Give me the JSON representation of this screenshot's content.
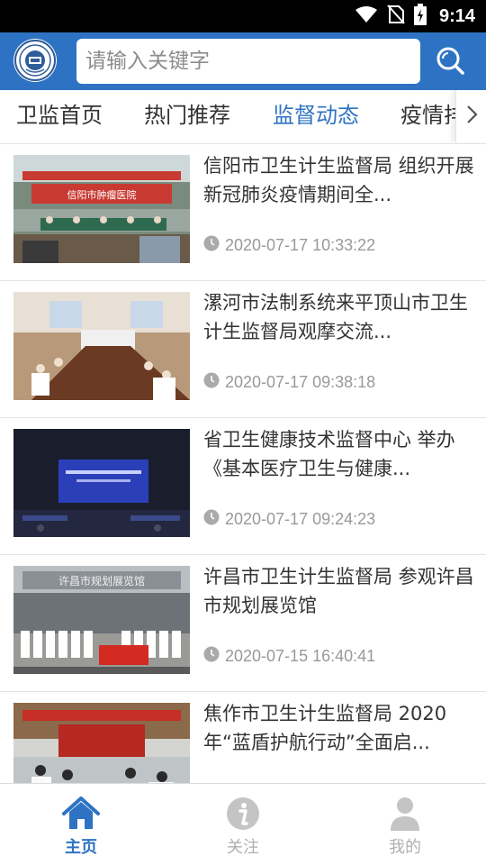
{
  "status_bar": {
    "time": "9:14",
    "icons": [
      "wifi-icon",
      "no-sim-icon",
      "battery-charging-icon"
    ]
  },
  "header": {
    "logo_icon": "agency-emblem",
    "search": {
      "placeholder": "请输入关键字",
      "value": ""
    },
    "search_icon": "search-icon"
  },
  "tabs": {
    "items": [
      {
        "label": "卫监首页",
        "active": false
      },
      {
        "label": "热门推荐",
        "active": false
      },
      {
        "label": "监督动态",
        "active": true
      },
      {
        "label": "疫情排",
        "active": false
      }
    ],
    "more_icon": "chevron-right-icon"
  },
  "news": [
    {
      "title": "信阳市卫生计生监督局 组织开展新冠肺炎疫情期间全...",
      "time": "2020-07-17 10:33:22",
      "thumb_banner": "信阳市肿瘤医院"
    },
    {
      "title": "漯河市法制系统来平顶山市卫生计生监督局观摩交流...",
      "time": "2020-07-17 09:38:18",
      "thumb_banner": ""
    },
    {
      "title": "省卫生健康技术监督中心 举办《基本医疗卫生与健康...",
      "time": "2020-07-17 09:24:23",
      "thumb_banner": ""
    },
    {
      "title": "许昌市卫生计生监督局 参观许昌市规划展览馆",
      "time": "2020-07-15 16:40:41",
      "thumb_banner": "许昌市规划展览馆"
    },
    {
      "title": "焦作市卫生计生监督局 2020年“蓝盾护航行动”全面启...",
      "time": "",
      "thumb_banner": ""
    }
  ],
  "bottom_nav": {
    "items": [
      {
        "label": "主页",
        "icon": "home-icon",
        "active": true
      },
      {
        "label": "关注",
        "icon": "info-icon",
        "active": false
      },
      {
        "label": "我的",
        "icon": "user-icon",
        "active": false
      }
    ]
  },
  "colors": {
    "primary": "#2e73c3",
    "status_bar": "#000000",
    "text": "#333333",
    "muted": "#999999",
    "inactive_nav": "#b0b0b0"
  }
}
